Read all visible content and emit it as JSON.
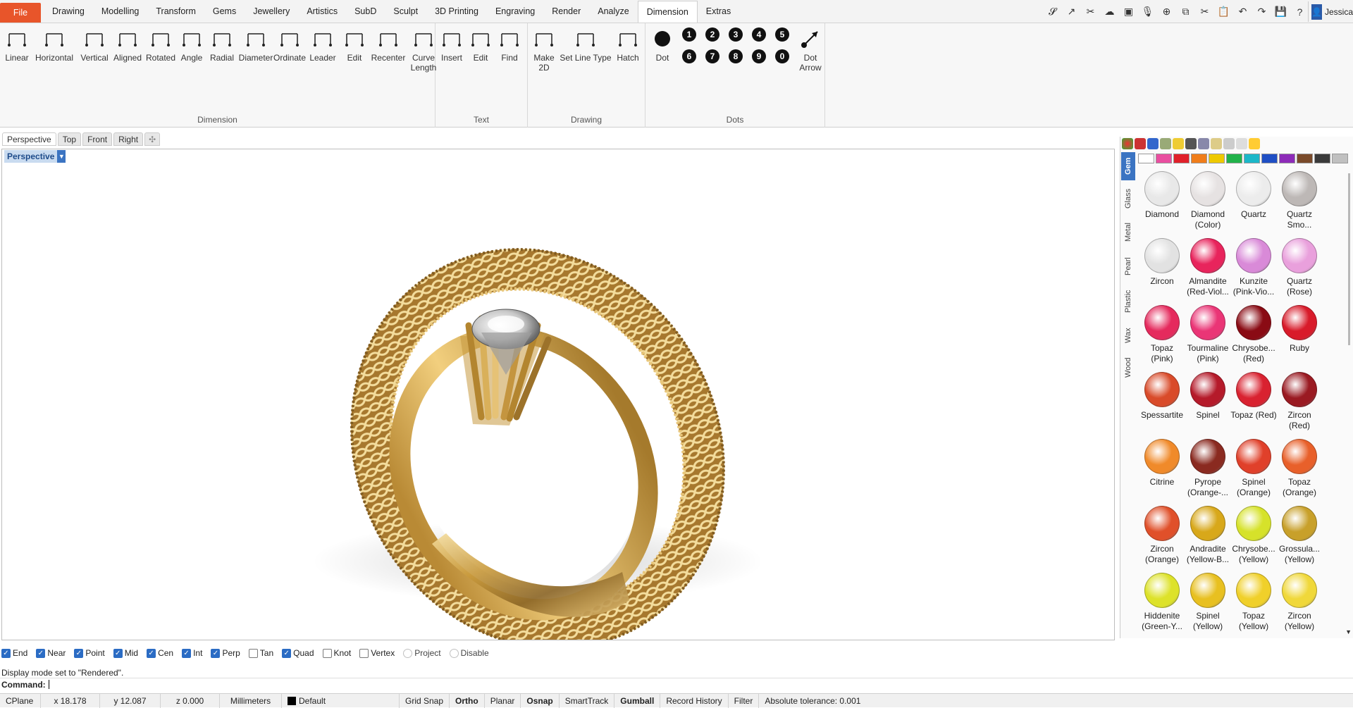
{
  "menu": {
    "items": [
      "File",
      "Drawing",
      "Modelling",
      "Transform",
      "Gems",
      "Jewellery",
      "Artistics",
      "SubD",
      "Sculpt",
      "3D Printing",
      "Engraving",
      "Render",
      "Analyze",
      "Dimension",
      "Extras"
    ],
    "active": "Dimension"
  },
  "quick_tools": [
    "curve-icon",
    "curve-edit-icon",
    "cut-icon",
    "cloud-icon",
    "clapper-icon",
    "mic-icon",
    "zoom-icon",
    "copy-icon",
    "scissors-icon",
    "paste-icon",
    "undo-icon",
    "redo-icon",
    "save-icon",
    "help-icon"
  ],
  "user": {
    "name": "Jessica"
  },
  "ribbon": {
    "dimension_tools": [
      {
        "label": "Linear",
        "icon": "linear-dimension-icon"
      },
      {
        "label": "Horizontal",
        "icon": "horizontal-dimension-icon"
      },
      {
        "label": "Vertical",
        "icon": "vertical-dimension-icon"
      },
      {
        "label": "Aligned",
        "icon": "aligned-dimension-icon"
      },
      {
        "label": "Rotated",
        "icon": "rotated-dimension-icon"
      },
      {
        "label": "Angle",
        "icon": "angle-dimension-icon"
      },
      {
        "label": "Radial",
        "icon": "radial-dimension-icon"
      },
      {
        "label": "Diameter",
        "icon": "diameter-dimension-icon"
      },
      {
        "label": "Ordinate",
        "icon": "ordinate-dimension-icon"
      },
      {
        "label": "Leader",
        "icon": "leader-icon"
      },
      {
        "label": "Edit",
        "icon": "edit-dimension-icon"
      },
      {
        "label": "Recenter",
        "icon": "recenter-icon"
      },
      {
        "label": "Curve Length",
        "icon": "curve-length-icon"
      }
    ],
    "dimension_group": "Dimension",
    "text_tools": [
      {
        "label": "Insert",
        "icon": "insert-text-icon"
      },
      {
        "label": "Edit",
        "icon": "edit-text-icon"
      },
      {
        "label": "Find",
        "icon": "find-text-icon"
      }
    ],
    "text_group": "Text",
    "drawing_tools": [
      {
        "label": "Make 2D",
        "icon": "make-2d-icon"
      },
      {
        "label": "Set Line Type",
        "icon": "line-type-icon"
      },
      {
        "label": "Hatch",
        "icon": "hatch-icon"
      }
    ],
    "drawing_group": "Drawing",
    "dot_tool": {
      "label": "Dot",
      "icon": "dot-icon"
    },
    "dot_numbers_top": [
      "1",
      "2",
      "3",
      "4",
      "5"
    ],
    "dot_numbers_bottom": [
      "6",
      "7",
      "8",
      "9",
      "0"
    ],
    "dot_arrow": {
      "label": "Dot Arrow",
      "icon": "dot-arrow-icon"
    },
    "dots_group": "Dots"
  },
  "viewport_tabs": [
    "Perspective",
    "Top",
    "Front",
    "Right"
  ],
  "viewport": {
    "active_label": "Perspective"
  },
  "panel": {
    "side_tabs": [
      "Gem",
      "Glass",
      "Metal",
      "Pearl",
      "Plastic",
      "Wax",
      "Wood"
    ],
    "active_side_tab": "Gem",
    "swatch_colors": [
      "#ffffff",
      "#e94ea0",
      "#e0202a",
      "#f07d1a",
      "#eec900",
      "#21b24a",
      "#1bb7c8",
      "#1f4fc4",
      "#8d2bb8",
      "#7a4a2a",
      "#3a3a3a",
      "#c0c0c0"
    ],
    "gems": [
      {
        "name": "Diamond",
        "sub": "",
        "color": "#e8e8e8"
      },
      {
        "name": "Diamond",
        "sub": "(Color)",
        "color": "#e6e2e2"
      },
      {
        "name": "Quartz",
        "sub": "",
        "color": "#ececec"
      },
      {
        "name": "Quartz",
        "sub": "Smo...",
        "color": "#bdb8b6"
      },
      {
        "name": "Zircon",
        "sub": "",
        "color": "#e2e2e2"
      },
      {
        "name": "Almandite",
        "sub": "(Red-Viol...",
        "color": "#e8245c"
      },
      {
        "name": "Kunzite",
        "sub": "(Pink-Vio...",
        "color": "#d98ad8"
      },
      {
        "name": "Quartz",
        "sub": "(Rose)",
        "color": "#e9a0dc"
      },
      {
        "name": "Topaz",
        "sub": "(Pink)",
        "color": "#e52a5d"
      },
      {
        "name": "Tourmaline",
        "sub": "(Pink)",
        "color": "#ea3576"
      },
      {
        "name": "Chrysobe...",
        "sub": "(Red)",
        "color": "#8a0b14"
      },
      {
        "name": "Ruby",
        "sub": "",
        "color": "#d81b2a"
      },
      {
        "name": "Spessartite",
        "sub": "",
        "color": "#d94b2a"
      },
      {
        "name": "Spinel",
        "sub": "",
        "color": "#b51a2a"
      },
      {
        "name": "Topaz (Red)",
        "sub": "",
        "color": "#d92230"
      },
      {
        "name": "Zircon",
        "sub": "(Red)",
        "color": "#9a1a22"
      },
      {
        "name": "Citrine",
        "sub": "",
        "color": "#f08a2a"
      },
      {
        "name": "Pyrope",
        "sub": "(Orange-...",
        "color": "#8a2a20"
      },
      {
        "name": "Spinel",
        "sub": "(Orange)",
        "color": "#e0402a"
      },
      {
        "name": "Topaz",
        "sub": "(Orange)",
        "color": "#e8602a"
      },
      {
        "name": "Zircon",
        "sub": "(Orange)",
        "color": "#e0502a"
      },
      {
        "name": "Andradite",
        "sub": "(Yellow-B...",
        "color": "#d8a81a"
      },
      {
        "name": "Chrysobe...",
        "sub": "(Yellow)",
        "color": "#d6e22a"
      },
      {
        "name": "Grossula...",
        "sub": "(Yellow)",
        "color": "#c8a02a"
      },
      {
        "name": "Hiddenite",
        "sub": "(Green-Y...",
        "color": "#dde22a"
      },
      {
        "name": "Spinel",
        "sub": "(Yellow)",
        "color": "#e8c020"
      },
      {
        "name": "Topaz",
        "sub": "(Yellow)",
        "color": "#f0d02a"
      },
      {
        "name": "Zircon",
        "sub": "(Yellow)",
        "color": "#f0d83a"
      }
    ]
  },
  "osnaps": [
    {
      "label": "End",
      "checked": true
    },
    {
      "label": "Near",
      "checked": true
    },
    {
      "label": "Point",
      "checked": true
    },
    {
      "label": "Mid",
      "checked": true
    },
    {
      "label": "Cen",
      "checked": true
    },
    {
      "label": "Int",
      "checked": true
    },
    {
      "label": "Perp",
      "checked": true
    },
    {
      "label": "Tan",
      "checked": false
    },
    {
      "label": "Quad",
      "checked": true
    },
    {
      "label": "Knot",
      "checked": false
    },
    {
      "label": "Vertex",
      "checked": false
    },
    {
      "label": "Project",
      "checked": false,
      "round": true
    },
    {
      "label": "Disable",
      "checked": false,
      "round": true
    }
  ],
  "command": {
    "history": "Display mode set to \"Rendered\".",
    "prompt": "Command:"
  },
  "status": {
    "cplane": "CPlane",
    "x": "x 18.178",
    "y": "y 12.087",
    "z": "z 0.000",
    "units": "Millimeters",
    "layer": "Default",
    "grid_snap": "Grid Snap",
    "ortho": "Ortho",
    "planar": "Planar",
    "osnap": "Osnap",
    "smarttrack": "SmartTrack",
    "gumball": "Gumball",
    "record_history": "Record History",
    "filter": "Filter",
    "tolerance": "Absolute tolerance: 0.001"
  }
}
